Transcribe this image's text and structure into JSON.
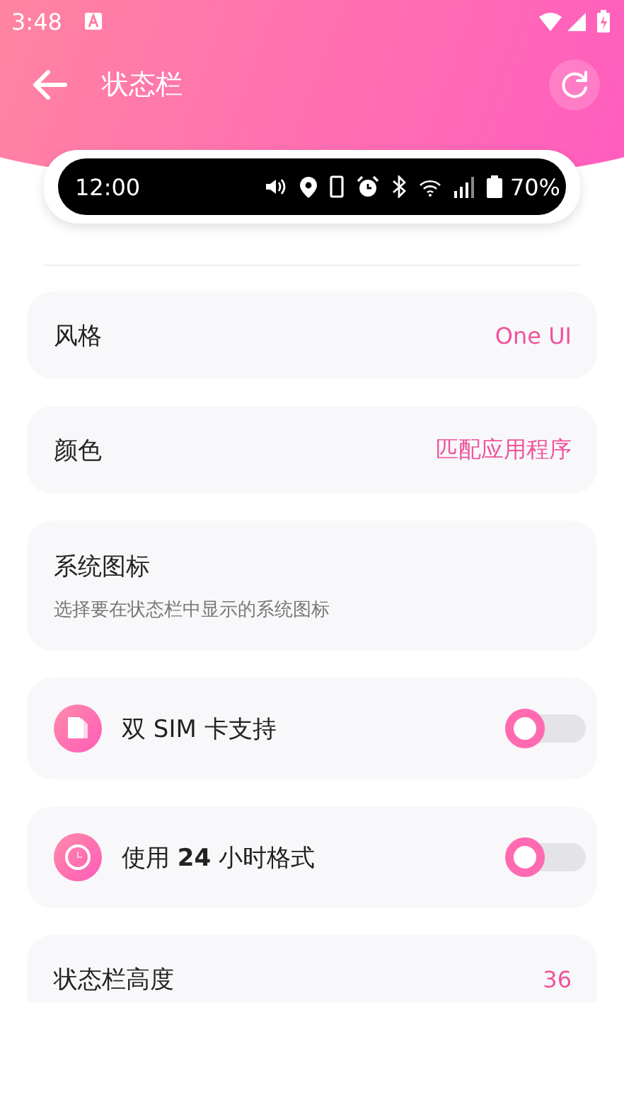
{
  "status_bar": {
    "time": "3:48"
  },
  "app_bar": {
    "title": "状态栏"
  },
  "preview": {
    "time": "12:00",
    "battery": "70%"
  },
  "settings": [
    {
      "kind": "value",
      "label": "风格",
      "value": "One UI"
    },
    {
      "kind": "value",
      "label": "颜色",
      "value": "匹配应用程序"
    },
    {
      "kind": "description",
      "label": "系统图标",
      "description": "选择要在状态栏中显示的系统图标"
    },
    {
      "kind": "toggle",
      "label": "双 SIM 卡支持",
      "on": false
    },
    {
      "kind": "toggle",
      "label": "使用 **24** 小时格式",
      "on": false
    },
    {
      "kind": "value",
      "label": "状态栏高度",
      "value": "36"
    }
  ]
}
